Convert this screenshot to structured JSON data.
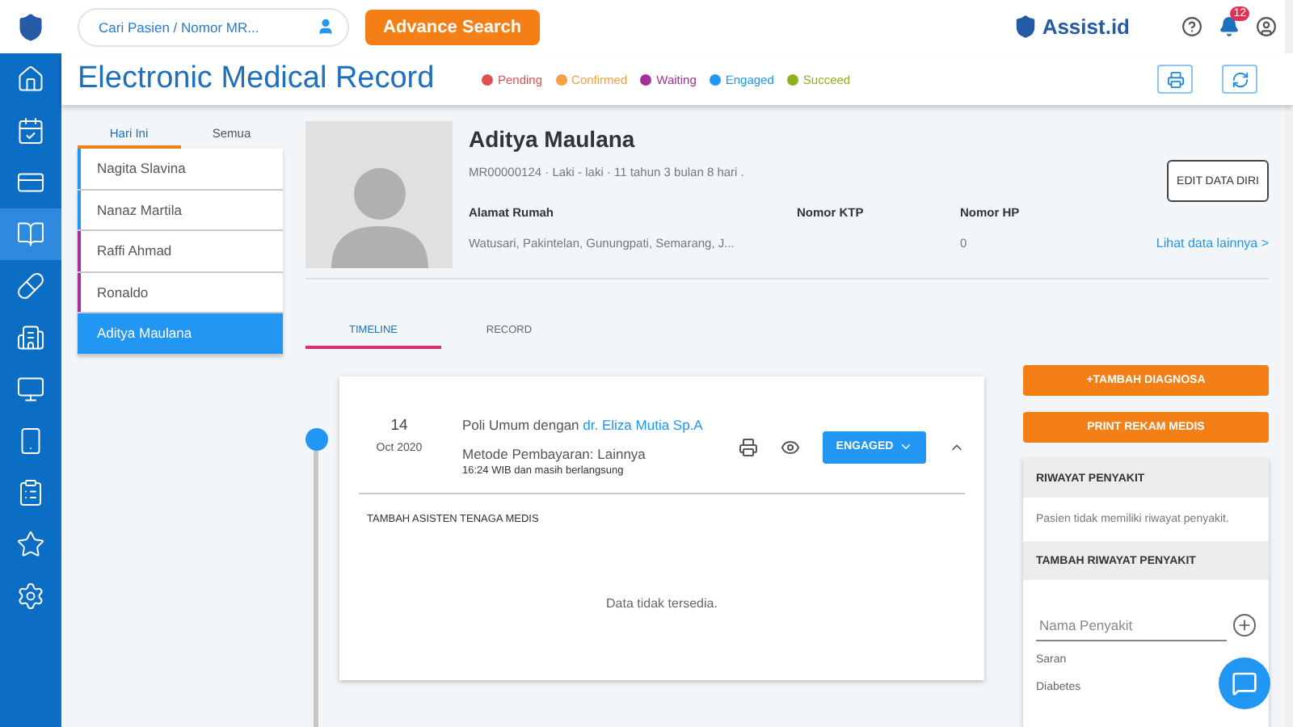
{
  "header": {
    "search": {
      "placeholder": "Cari Pasien / Nomor MR..."
    },
    "advance_search": "Advance Search",
    "brand": "Assist.id",
    "notification_count": "12"
  },
  "sidebar": {
    "items": [
      {
        "selected": false
      },
      {
        "selected": false
      },
      {
        "selected": false
      },
      {
        "selected": true
      },
      {
        "selected": false
      },
      {
        "selected": false
      },
      {
        "selected": false
      },
      {
        "selected": false
      },
      {
        "selected": false
      },
      {
        "selected": false
      },
      {
        "selected": false
      }
    ]
  },
  "page_title": "Electronic Medical Record",
  "legend": [
    {
      "label": "Pending",
      "color": "#e0504f"
    },
    {
      "label": "Confirmed",
      "color": "#f5a044"
    },
    {
      "label": "Waiting",
      "color": "#a2309b"
    },
    {
      "label": "Engaged",
      "color": "#2196f3"
    },
    {
      "label": "Succeed",
      "color": "#8db21f"
    }
  ],
  "list_tabs": [
    {
      "label": "Hari Ini",
      "selected": true
    },
    {
      "label": "Semua",
      "selected": false
    }
  ],
  "patients": [
    {
      "name": "Nagita Slavina",
      "color": "#2196f3",
      "selected": false
    },
    {
      "name": "Nanaz Martila",
      "color": "#2196f3",
      "selected": false
    },
    {
      "name": "Raffi Ahmad",
      "color": "#a2309b",
      "selected": false
    },
    {
      "name": "Ronaldo",
      "color": "#a2309b",
      "selected": false
    },
    {
      "name": "Aditya Maulana",
      "color": "#2196f3",
      "selected": true
    }
  ],
  "patient": {
    "name": "Aditya Maulana",
    "summary": "MR00000124 · Laki - laki · 11 tahun 3 bulan 8 hari .",
    "fields": [
      {
        "label": "Alamat Rumah",
        "value": "Watusari, Pakintelan, Gunungpati, Semarang, J..."
      },
      {
        "label": "Nomor KTP"
      },
      {
        "label": "Nomor HP",
        "value": "0"
      }
    ],
    "edit": "EDIT DATA DIRI",
    "more": "Lihat data lainnya >"
  },
  "record_tabs": [
    {
      "label": "TIMELINE",
      "selected": true
    },
    {
      "label": "RECORD",
      "selected": false
    }
  ],
  "visit": {
    "day": "14",
    "month_year": "Oct 2020",
    "title_prefix": "Poli Umum dengan",
    "doctor": "dr. Eliza Mutia Sp.A",
    "payment": "Metode Pembayaran: Lainnya",
    "time": "16:24 WIB dan masih berlangsung",
    "status": "ENGAGED",
    "expanded": true,
    "section": "TAMBAH ASISTEN TENAGA MEDIS",
    "empty": "Data tidak tersedia."
  },
  "actions": [
    "+TAMBAH DIAGNOSA",
    "PRINT REKAM MEDIS"
  ],
  "history": {
    "title": "RIWAYAT PENYAKIT",
    "empty": "Pasien tidak memiliki riwayat penyakit.",
    "add_title": "TAMBAH RIWAYAT PENYAKIT",
    "placeholder": "Nama Penyakit",
    "suggest_label": "Saran",
    "suggestions": [
      "Diabetes"
    ]
  }
}
